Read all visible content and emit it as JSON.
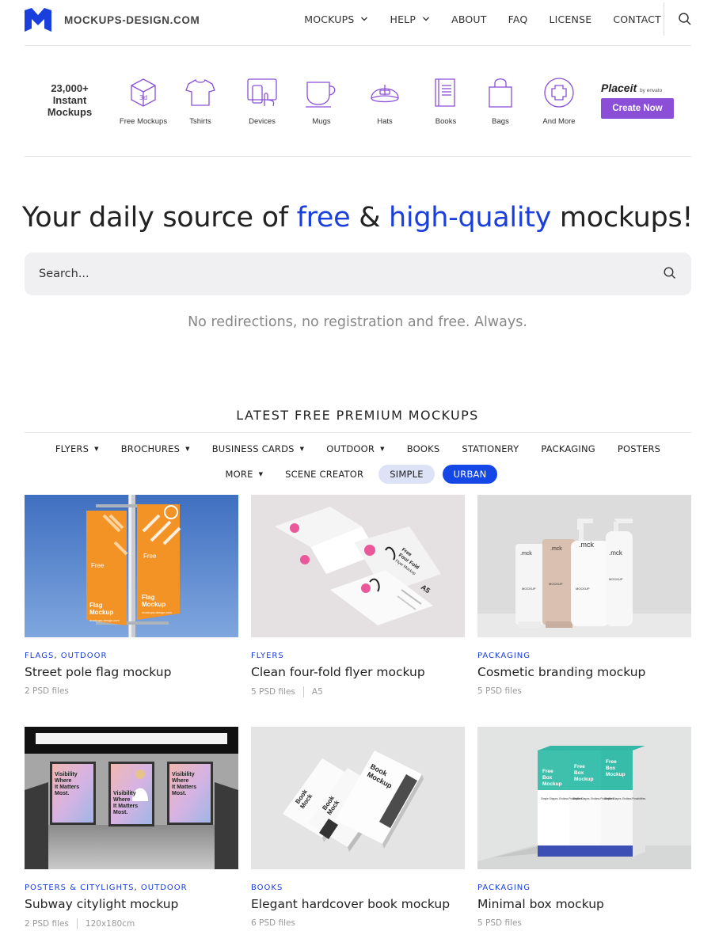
{
  "header": {
    "logo_text": "MOCKUPS-DESIGN.COM",
    "nav": [
      {
        "label": "MOCKUPS",
        "dropdown": true
      },
      {
        "label": "HELP",
        "dropdown": true
      },
      {
        "label": "ABOUT",
        "dropdown": false
      },
      {
        "label": "FAQ",
        "dropdown": false
      },
      {
        "label": "LICENSE",
        "dropdown": false
      },
      {
        "label": "CONTACT",
        "dropdown": false
      }
    ]
  },
  "categories": {
    "count_lines": [
      "23,000+",
      "Instant",
      "Mockups"
    ],
    "items": [
      {
        "label": "Free Mockups",
        "icon": "cube-3d-icon"
      },
      {
        "label": "Tshirts",
        "icon": "tshirt-icon"
      },
      {
        "label": "Devices",
        "icon": "devices-icon"
      },
      {
        "label": "Mugs",
        "icon": "mug-icon"
      },
      {
        "label": "Hats",
        "icon": "cap-icon"
      },
      {
        "label": "Books",
        "icon": "book-icon"
      },
      {
        "label": "Bags",
        "icon": "bag-icon"
      },
      {
        "label": "And More",
        "icon": "plus-circle-icon"
      }
    ],
    "placeit": {
      "logo": "Placeit",
      "by": "by envato",
      "button": "Create Now"
    }
  },
  "hero": {
    "title_before": "Your daily source of ",
    "title_hl1": "free",
    "title_mid": " & ",
    "title_hl2": "high-quality",
    "title_after": " mockups!",
    "search_placeholder": "Search...",
    "tagline": "No redirections, no registration and free. Always."
  },
  "latest": {
    "title": "LATEST FREE PREMIUM MOCKUPS",
    "filters_row1": [
      {
        "label": "FLYERS",
        "dropdown": true
      },
      {
        "label": "BROCHURES",
        "dropdown": true
      },
      {
        "label": "BUSINESS CARDS",
        "dropdown": true
      },
      {
        "label": "OUTDOOR",
        "dropdown": true
      },
      {
        "label": "BOOKS",
        "dropdown": false
      },
      {
        "label": "STATIONERY",
        "dropdown": false
      },
      {
        "label": "PACKAGING",
        "dropdown": false
      },
      {
        "label": "POSTERS",
        "dropdown": false
      }
    ],
    "filters_row2": [
      {
        "label": "MORE",
        "dropdown": true,
        "style": "plain"
      },
      {
        "label": "SCENE CREATOR",
        "dropdown": false,
        "style": "plain"
      },
      {
        "label": "SIMPLE",
        "dropdown": false,
        "style": "pill"
      },
      {
        "label": "URBAN",
        "dropdown": false,
        "style": "active"
      }
    ]
  },
  "cards": [
    {
      "cats": [
        "FLAGS",
        "OUTDOOR"
      ],
      "title": "Street pole flag mockup",
      "meta": [
        "2 PSD files"
      ]
    },
    {
      "cats": [
        "FLYERS"
      ],
      "title": "Clean four-fold flyer mockup",
      "meta": [
        "5 PSD files",
        "A5"
      ]
    },
    {
      "cats": [
        "PACKAGING"
      ],
      "title": "Cosmetic branding mockup",
      "meta": [
        "5 PSD files"
      ]
    },
    {
      "cats": [
        "POSTERS & CITYLIGHTS",
        "OUTDOOR"
      ],
      "title": "Subway citylight mockup",
      "meta": [
        "2 PSD files",
        "120x180cm"
      ]
    },
    {
      "cats": [
        "BOOKS"
      ],
      "title": "Elegant hardcover book mockup",
      "meta": [
        "6 PSD files"
      ]
    },
    {
      "cats": [
        "PACKAGING"
      ],
      "title": "Minimal box mockup",
      "meta": [
        "5 PSD files"
      ]
    }
  ],
  "thumb_text": {
    "flag": {
      "word": "Free",
      "line1": "Flag",
      "line2": "Mockup",
      "url": "mockups-design.com"
    },
    "flyer": {
      "title1": "Free",
      "title2": "Four Fold",
      "title3": "Flyer Mockup",
      "size": "A5",
      "brand": ".mck"
    },
    "cosmetic": {
      "brand": ".mck",
      "label": "MOCKUP"
    },
    "subway": {
      "poster_lines": [
        "Visibility",
        "Where",
        "It Matters",
        "Most."
      ]
    },
    "book": {
      "line1": "Book",
      "line2": "Mockup",
      "short": "Mock"
    },
    "box": {
      "lines": [
        "Free",
        "Box",
        "Mockup"
      ],
      "sub": "Simple Shapes. Endless Possibilities."
    }
  },
  "colors": {
    "accent": "#1447e6",
    "link": "#1a3fdc",
    "purple": "#8a4fd6",
    "icon": "#8a4fd6"
  }
}
